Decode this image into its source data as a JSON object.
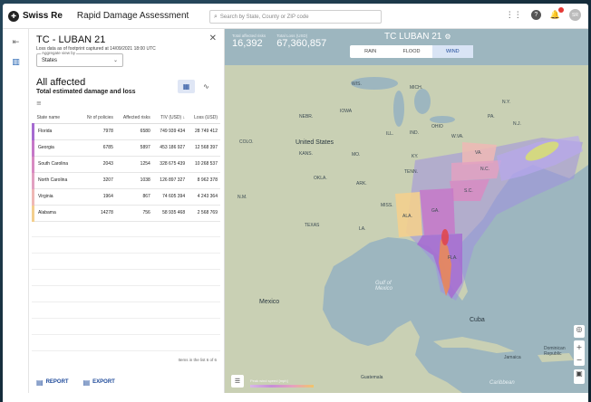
{
  "app": {
    "brand": "Swiss Re",
    "title": "Rapid Damage Assessment",
    "search_placeholder": "Search by State, County or ZIP code",
    "avatar_initials": "SR"
  },
  "panel": {
    "title": "TC - LUBAN 21",
    "loss_note": "Loss data as of footprint captured at 14/09/2021 18:00 UTC",
    "aggregate_label": "Aggregate view by",
    "aggregate_value": "States",
    "section_title": "All affected",
    "section_subtitle": "Total estimated damage and loss",
    "columns": [
      "State name",
      "Nr of policies",
      "Affected risks",
      "TIV (USD)",
      "Loss (USD)"
    ],
    "rows": [
      {
        "state": "Florida",
        "policies": "7978",
        "risks": "6580",
        "tiv": "749 939 434",
        "loss": "28 749 412",
        "color": "#a66bd1"
      },
      {
        "state": "Georgia",
        "policies": "6785",
        "risks": "5897",
        "tiv": "453 186 927",
        "loss": "12 568 397",
        "color": "#c678c8"
      },
      {
        "state": "South Carolina",
        "policies": "2043",
        "risks": "1254",
        "tiv": "328 675 439",
        "loss": "10 268 537",
        "color": "#d88bc2"
      },
      {
        "state": "North Carolina",
        "policies": "3207",
        "risks": "1038",
        "tiv": "126 897 327",
        "loss": "8 962 378",
        "color": "#e2a1c1"
      },
      {
        "state": "Virginia",
        "policies": "1964",
        "risks": "867",
        "tiv": "74 605 394",
        "loss": "4 243 364",
        "color": "#efb8b5"
      },
      {
        "state": "Alabama",
        "policies": "14278",
        "risks": "756",
        "tiv": "58 935 468",
        "loss": "2 568 769",
        "color": "#f3cf8e"
      }
    ],
    "items_note": "Items in the list 6 of 6",
    "report_label": "REPORT",
    "export_label": "EXPORT"
  },
  "map": {
    "affected_risks_label": "Total affected risks",
    "affected_risks_value": "16,392",
    "total_loss_label": "Total Loss (USD)",
    "total_loss_value": "67,360,857",
    "event_title": "TC LUBAN 21",
    "tabs": [
      "RAIN",
      "FLOOD",
      "WIND"
    ],
    "active_tab": "WIND",
    "legend_text": "Peak wind speed [mph]",
    "labels": {
      "us": "United States",
      "mexico": "Mexico",
      "gulf": "Gulf of\nMexico",
      "cuba": "Cuba",
      "caribbean": "Caribbean",
      "guatemala": "Guatemala",
      "dominican": "Dominican\nRepublic",
      "jamaica": "Jamaica",
      "wis": "WIS.",
      "mich": "MICH.",
      "iowa": "IOWA",
      "ill": "ILL.",
      "ind": "IND.",
      "ohio": "OHIO",
      "nebr": "NEBR.",
      "kans": "KANS.",
      "colo": "COLO.",
      "mo": "MO.",
      "ky": "KY.",
      "wva": "W.VA.",
      "va": "VA.",
      "nc": "N.C.",
      "sc": "S.C.",
      "tenn": "TENN.",
      "ark": "ARK.",
      "okla": "OKLA.",
      "miss": "MISS.",
      "ala": "ALA.",
      "ga": "GA.",
      "la": "LA.",
      "texas": "TEXAS",
      "nm": "N.M.",
      "fla": "FLA.",
      "pa": "PA.",
      "ny": "N.Y.",
      "nj": "N.J."
    }
  }
}
